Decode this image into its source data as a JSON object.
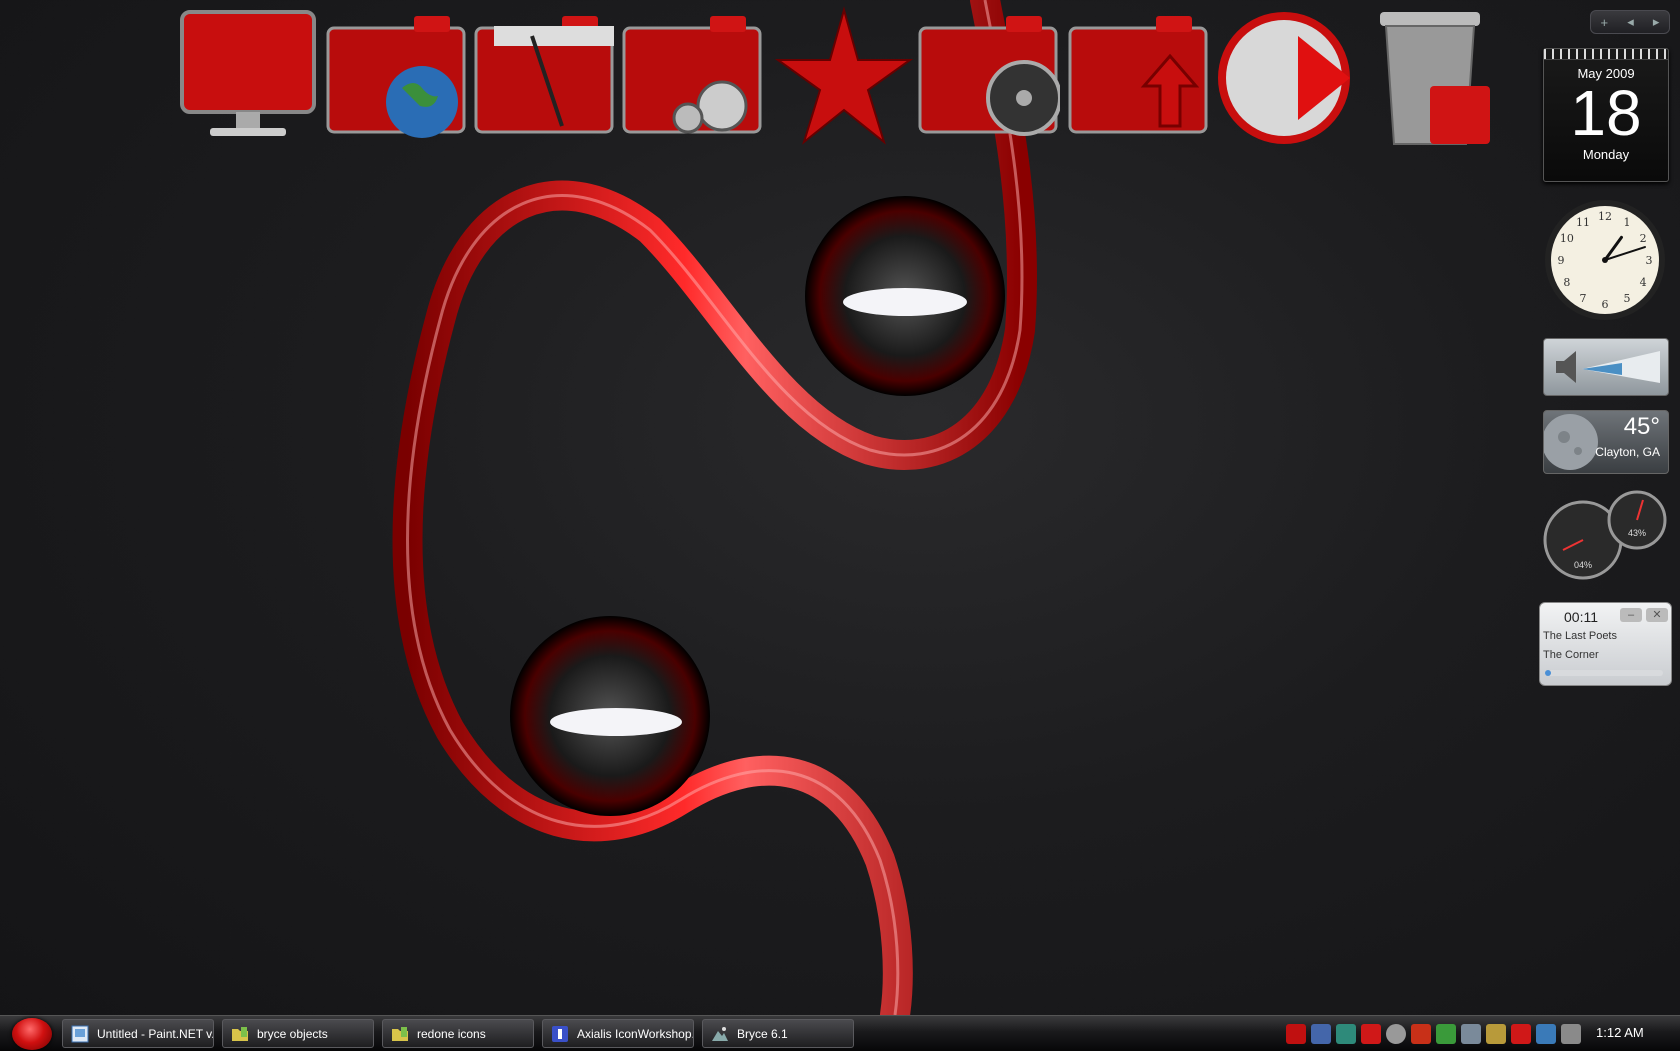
{
  "colors": {
    "accent": "#d41414",
    "background": "#1c1c1e",
    "taskbar": "#1a1a1c"
  },
  "dock": {
    "items": [
      {
        "icon": "monitor-icon"
      },
      {
        "icon": "globe-folder-icon"
      },
      {
        "icon": "documents-folder-icon"
      },
      {
        "icon": "music-folder-icon"
      },
      {
        "icon": "star-icon"
      },
      {
        "icon": "film-reel-folder-icon"
      },
      {
        "icon": "upload-folder-icon"
      },
      {
        "icon": "media-player-icon"
      },
      {
        "icon": "recycle-bin-icon"
      }
    ]
  },
  "sidebar": {
    "controls": {
      "add": "+",
      "prev": "◂",
      "next": "▸"
    },
    "calendar": {
      "month": "May 2009",
      "day": "18",
      "weekday": "Monday"
    },
    "clock": {
      "hour": 1,
      "minute": 12
    },
    "weather": {
      "temp": "45°",
      "city": "Clayton, GA"
    },
    "cpu_meter": {
      "cpu": "04%",
      "ram": "43%"
    },
    "media_player": {
      "time": "00:11",
      "artist": "The Last Poets",
      "track": "The Corner",
      "progress": 0.05,
      "minimize": "–",
      "close": "✕"
    }
  },
  "taskbar": {
    "tasks": [
      {
        "label": "Untitled - Paint.NET v..."
      },
      {
        "label": "bryce objects"
      },
      {
        "label": "redone icons"
      },
      {
        "label": "Axialis IconWorkshop..."
      },
      {
        "label": "Bryce 6.1"
      }
    ],
    "clock": "1:12 AM"
  }
}
